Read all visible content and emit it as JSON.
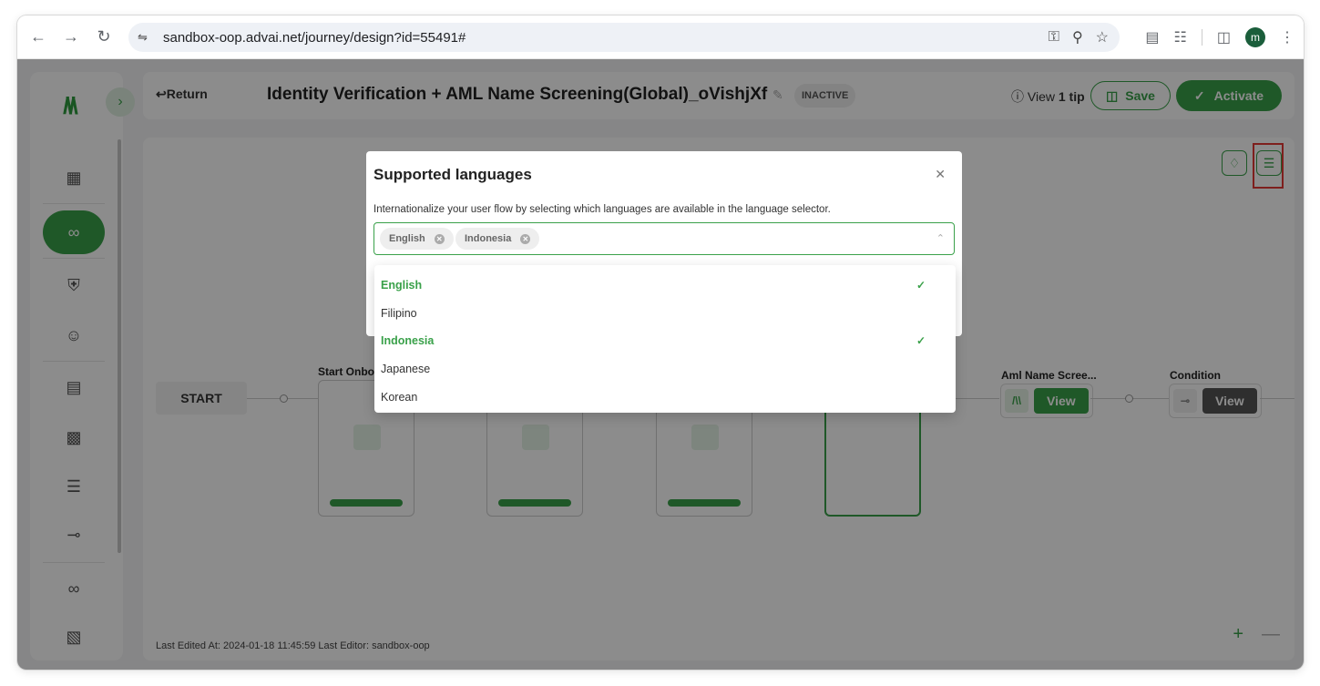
{
  "browser": {
    "url": "sandbox-oop.advai.net/journey/design?id=55491#",
    "profile_initial": "m",
    "icons": [
      "back-icon",
      "forward-icon",
      "reload-icon",
      "site-info-icon",
      "password-key-icon",
      "zoom-icon",
      "bookmark-star-icon",
      "reading-list-icon",
      "extensions-icon",
      "side-panel-icon",
      "menu-icon"
    ]
  },
  "header": {
    "return_label": "↩Return",
    "title": "Identity Verification + AML Name Screening(Global)_oVishjXf",
    "status": "INACTIVE",
    "tip_prefix": "View ",
    "tip_bold": "1 tip",
    "save_label": "Save",
    "activate_label": "Activate"
  },
  "sidebar": {
    "items": [
      "dashboard-icon",
      "journey-icon",
      "shield-icon",
      "users-icon",
      "document-icon",
      "apps-icon",
      "list-icon",
      "share-icon",
      "link-icon",
      "widgets-icon"
    ],
    "active_index": 1
  },
  "canvas": {
    "start_label": "START",
    "nodes": [
      {
        "label": "Start Onbo"
      },
      {
        "label": "Aml Name Scree..."
      },
      {
        "label": "Condition"
      }
    ],
    "view_label": "View",
    "footer": "Last Edited At: 2024-01-18 11:45:59   Last Editor: sandbox-oop"
  },
  "modal": {
    "title": "Supported languages",
    "description": "Internationalize your user flow by selecting which languages are available in the language selector.",
    "selected_tags": [
      "English",
      "Indonesia"
    ],
    "options": [
      {
        "label": "English",
        "selected": true
      },
      {
        "label": "Filipino",
        "selected": false
      },
      {
        "label": "Indonesia",
        "selected": true
      },
      {
        "label": "Japanese",
        "selected": false
      },
      {
        "label": "Korean",
        "selected": false
      }
    ]
  },
  "colors": {
    "accent": "#3aa14a",
    "highlight": "#e53935"
  }
}
